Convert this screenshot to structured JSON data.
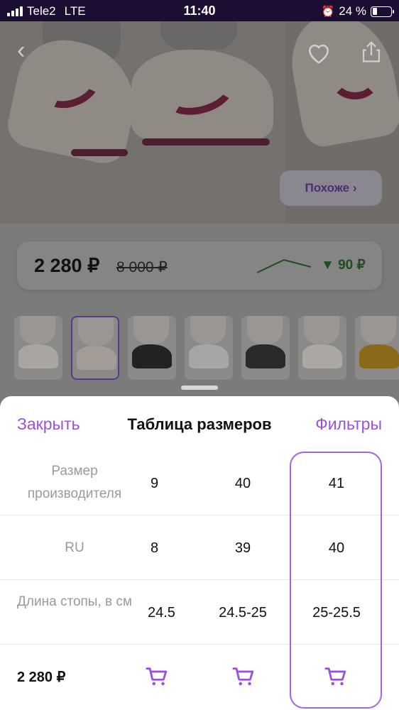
{
  "status_bar": {
    "carrier": "Tele2",
    "network": "LTE",
    "time": "11:40",
    "battery": "24 %",
    "battery_level": 0.24
  },
  "hero": {
    "similar_label": "Похоже ›",
    "icons": [
      "back-chevron-icon",
      "heart-icon",
      "share-icon"
    ]
  },
  "price_card": {
    "price": "2 280 ₽",
    "old_price": "8 000 ₽",
    "drop": "▼ 90 ₽",
    "drop_color": "#2e7d32"
  },
  "thumbnails": {
    "count": 7,
    "selected_index": 1
  },
  "size_sheet": {
    "close_label": "Закрыть",
    "title": "Таблица размеров",
    "filters_label": "Фильтры",
    "accent": "#9a52d8",
    "rows": [
      {
        "label": "Размер производителя",
        "values": [
          "9",
          "40",
          "41"
        ]
      },
      {
        "label": "RU",
        "values": [
          "8",
          "39",
          "40"
        ]
      },
      {
        "label": "Длина стопы, в см",
        "values": [
          "24.5",
          "24.5-25",
          "25-25.5"
        ]
      }
    ],
    "footer": {
      "price": "2 280 ₽"
    }
  }
}
